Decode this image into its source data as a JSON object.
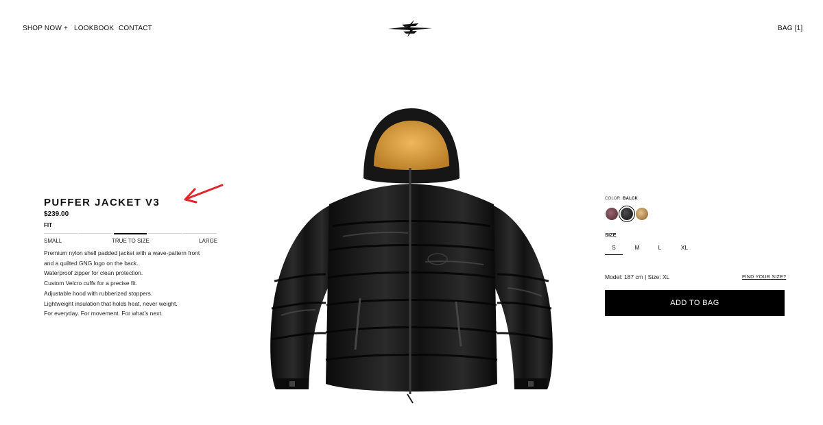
{
  "header": {
    "nav": [
      {
        "label": "SHOP NOW +"
      },
      {
        "label": "LOOKBOOK"
      },
      {
        "label": "CONTACT"
      }
    ],
    "bag_label": "BAG [1]",
    "logo_icon": "gng-logo-icon"
  },
  "product": {
    "title": "PUFFER JACKET V3",
    "price": "$239.00",
    "fit": {
      "label": "FIT",
      "small": "SMALL",
      "true_to_size": "TRUE TO SIZE",
      "large": "LARGE",
      "selected_position": "true-to-size"
    },
    "description": [
      "Premium nylon shell padded jacket with a wave-pattern front",
      "and a quilted GNG logo on the back.",
      "Waterproof zipper for clean protection.",
      "Custom Velcro cuffs for a precise fit.",
      "Adjustable hood with rubberized stoppers.",
      "Lightweight insulation that holds heat, never weight.",
      "For everyday. For movement. For what’s next."
    ],
    "annotation_color": "#e0262b"
  },
  "options": {
    "color_prefix": "COLOR:",
    "color_value": "BALCK",
    "swatches": [
      {
        "name": "burgundy",
        "color": "#6e3f46"
      },
      {
        "name": "black",
        "color": "#2a2a2a",
        "selected": true
      },
      {
        "name": "tan",
        "color": "#c69a55"
      }
    ],
    "size_label": "SIZE",
    "sizes": [
      "S",
      "M",
      "L",
      "XL"
    ],
    "selected_size": "S",
    "model_info": "Model: 187 cm | Size: XL",
    "find_size_label": "FIND YOUR SIZE?",
    "add_to_bag_label": "ADD TO BAG"
  }
}
